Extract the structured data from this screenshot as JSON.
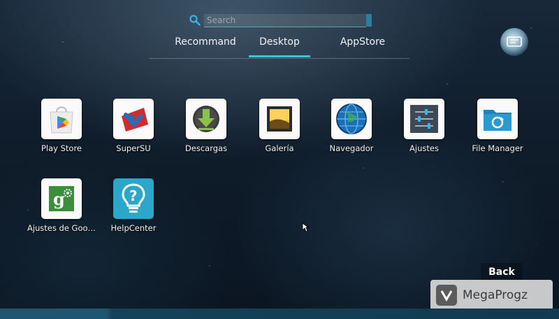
{
  "search": {
    "placeholder": "Search",
    "value": "",
    "icon": "search-icon"
  },
  "tabs": [
    {
      "label": "Recommand",
      "active": false
    },
    {
      "label": "Desktop",
      "active": true
    },
    {
      "label": "AppStore",
      "active": false
    }
  ],
  "apps": [
    {
      "label": "Play Store",
      "icon": "play-store-icon"
    },
    {
      "label": "SuperSU",
      "icon": "supersu-icon"
    },
    {
      "label": "Descargas",
      "icon": "download-icon"
    },
    {
      "label": "Galería",
      "icon": "gallery-icon"
    },
    {
      "label": "Navegador",
      "icon": "browser-globe-icon"
    },
    {
      "label": "Ajustes",
      "icon": "settings-sliders-icon"
    },
    {
      "label": "File Manager",
      "icon": "folder-icon"
    },
    {
      "label": "Ajustes de Goo…",
      "icon": "google-settings-icon"
    },
    {
      "label": "HelpCenter",
      "icon": "lightbulb-question-icon"
    }
  ],
  "back_label": "Back",
  "watermark": {
    "text": "MegaProgz"
  },
  "colors": {
    "accent": "#33c9d8",
    "bar": "#1e5570"
  }
}
